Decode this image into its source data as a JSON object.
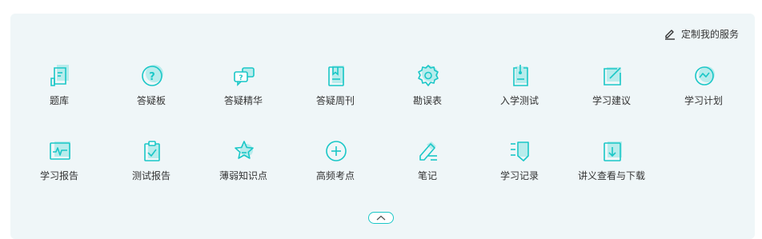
{
  "header": {
    "customize_label": "定制我的服务",
    "customize_icon": "pencil-icon"
  },
  "colors": {
    "accent": "#1ac7c7",
    "accent_light": "#b8ecec",
    "panel_bg": "#eff6f8",
    "label_text": "#333333"
  },
  "services": {
    "row1": [
      {
        "label": "题库",
        "icon": "question-bank-icon"
      },
      {
        "label": "答疑板",
        "icon": "question-mark-bubble-icon"
      },
      {
        "label": "答疑精华",
        "icon": "chat-bubbles-icon"
      },
      {
        "label": "答疑周刊",
        "icon": "bookmark-book-icon"
      },
      {
        "label": "勘误表",
        "icon": "gear-icon"
      },
      {
        "label": "入学测试",
        "icon": "pin-document-icon"
      },
      {
        "label": "学习建议",
        "icon": "edit-square-icon"
      },
      {
        "label": "学习计划",
        "icon": "trend-circle-icon"
      }
    ],
    "row2": [
      {
        "label": "学习报告",
        "icon": "pulse-monitor-icon"
      },
      {
        "label": "测试报告",
        "icon": "clipboard-check-icon"
      },
      {
        "label": "薄弱知识点",
        "icon": "star-icon"
      },
      {
        "label": "高频考点",
        "icon": "plus-circle-icon"
      },
      {
        "label": "笔记",
        "icon": "pen-note-icon"
      },
      {
        "label": "学习记录",
        "icon": "list-record-icon"
      },
      {
        "label": "讲义查看与下载",
        "icon": "download-document-icon"
      }
    ]
  },
  "collapse_button": {
    "icon": "chevron-up-icon"
  }
}
